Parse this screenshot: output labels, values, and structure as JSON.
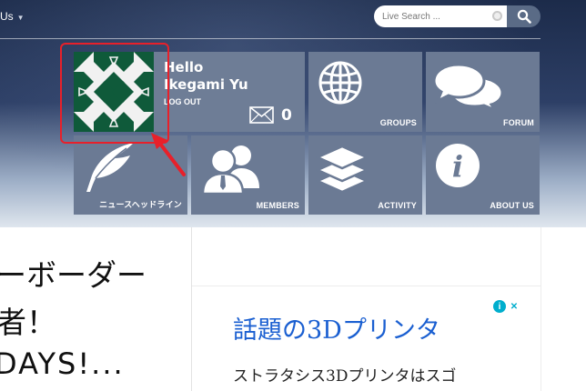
{
  "nav": {
    "partial_menu_label": "Us",
    "search_placeholder": "Live Search ..."
  },
  "profile": {
    "greeting": "Hello",
    "username": "Ikegami Yu",
    "logout_label": "LOG OUT",
    "message_count": "0"
  },
  "tiles": [
    {
      "label": "GROUPS",
      "icon": "globe-icon"
    },
    {
      "label": "FORUM",
      "icon": "speech-bubbles-icon"
    },
    {
      "label": "ニュースヘッドライン",
      "icon": "quill-feather-icon"
    },
    {
      "label": "MEMBERS",
      "icon": "users-icon"
    },
    {
      "label": "ACTIVITY",
      "icon": "layers-icon"
    },
    {
      "label": "ABOUT US",
      "icon": "info-icon"
    }
  ],
  "content": {
    "left_lines": [
      "ーボーダー",
      "者！",
      "DAYS!..."
    ]
  },
  "ad": {
    "title": "話題の3Dプリンタ",
    "body": "ストラタシス3Dプリンタはスゴ",
    "info_label": "i",
    "close_label": "✕"
  },
  "colors": {
    "tile": "#6b7a94",
    "header_dark": "#1c2b4a",
    "ad_link": "#1a5fd1",
    "highlight": "#e8202a",
    "avatar_green": "#0f5a3a"
  }
}
